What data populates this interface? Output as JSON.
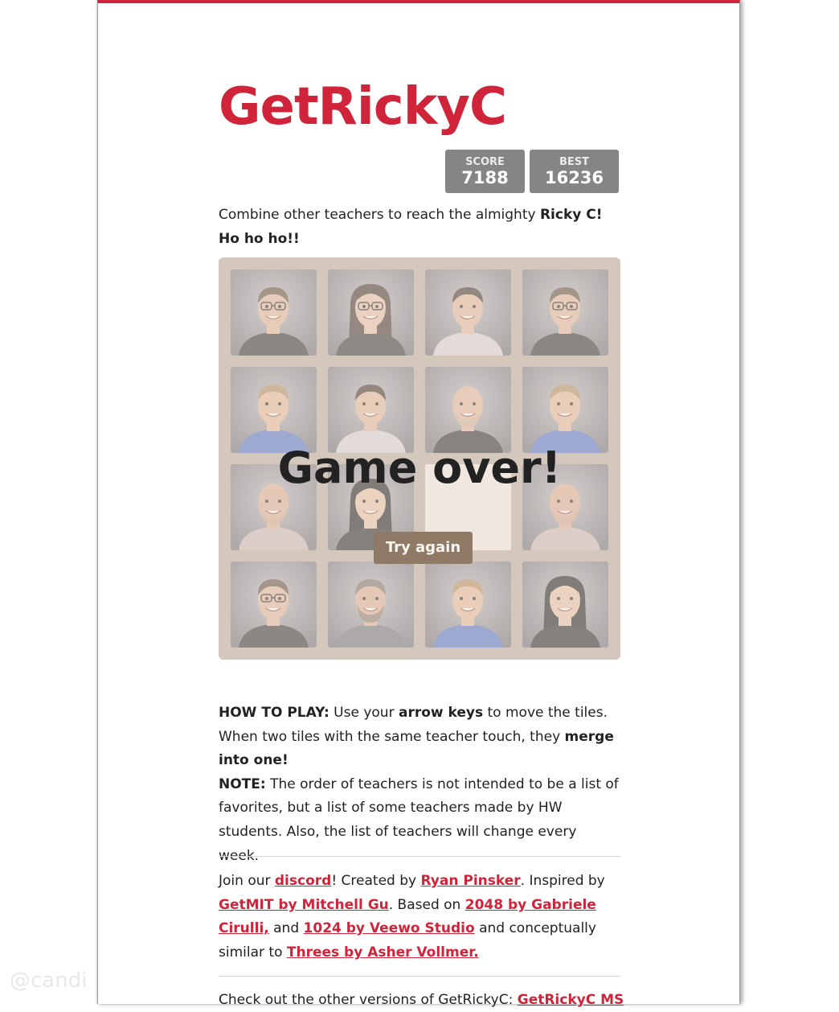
{
  "app": {
    "title": "GetRickyC",
    "accent_color": "#d0243a"
  },
  "scores": {
    "score_label": "SCORE",
    "score_value": "7188",
    "best_label": "BEST",
    "best_value": "16236"
  },
  "intro": {
    "text": "Combine other teachers to reach the almighty ",
    "bold": "Ricky C! Ho ho ho!!"
  },
  "board": {
    "tiles": [
      {
        "teacher": "glasses-man"
      },
      {
        "teacher": "glasses-woman"
      },
      {
        "teacher": "curly-man"
      },
      {
        "teacher": "glasses-man"
      },
      {
        "teacher": "blond-man"
      },
      {
        "teacher": "curly-man"
      },
      {
        "teacher": "bald-man"
      },
      {
        "teacher": "blond-man"
      },
      {
        "teacher": "bearded-man"
      },
      {
        "teacher": "asian-woman"
      },
      {
        "teacher": "empty"
      },
      {
        "teacher": "bearded-man"
      },
      {
        "teacher": "glasses-man"
      },
      {
        "teacher": "gray-beard-man"
      },
      {
        "teacher": "blond-man"
      },
      {
        "teacher": "asian-woman"
      }
    ],
    "game_over_text": "Game over!",
    "try_again_label": "Try again"
  },
  "howto": {
    "label": "HOW TO PLAY:",
    "t1": " Use your ",
    "b1": "arrow keys",
    "t2": " to move the tiles. When two tiles with the same teacher touch, they ",
    "b2": "merge into one!",
    "note_label": "NOTE:",
    "note_text": " The order of teachers is not intended to be a list of favorites, but a list of some teachers made by HW students. Also, the list of teachers will change every week."
  },
  "credits": {
    "t1": "Join our ",
    "discord": "discord",
    "t2": "! Created by ",
    "author": "Ryan Pinsker",
    "t3": ". Inspired by ",
    "getmit": "GetMIT by Mitchell Gu",
    "t4": ". Based on ",
    "link2048": "2048 by Gabriele Cirulli,",
    "t5": " and ",
    "link1024": "1024 by Veewo Studio",
    "t6": " and conceptually similar to ",
    "threes": "Threes by Asher Vollmer."
  },
  "more": {
    "text": "Check out the other versions of GetRickyC: ",
    "link": "GetRickyC MS"
  },
  "watermark": "@candi"
}
